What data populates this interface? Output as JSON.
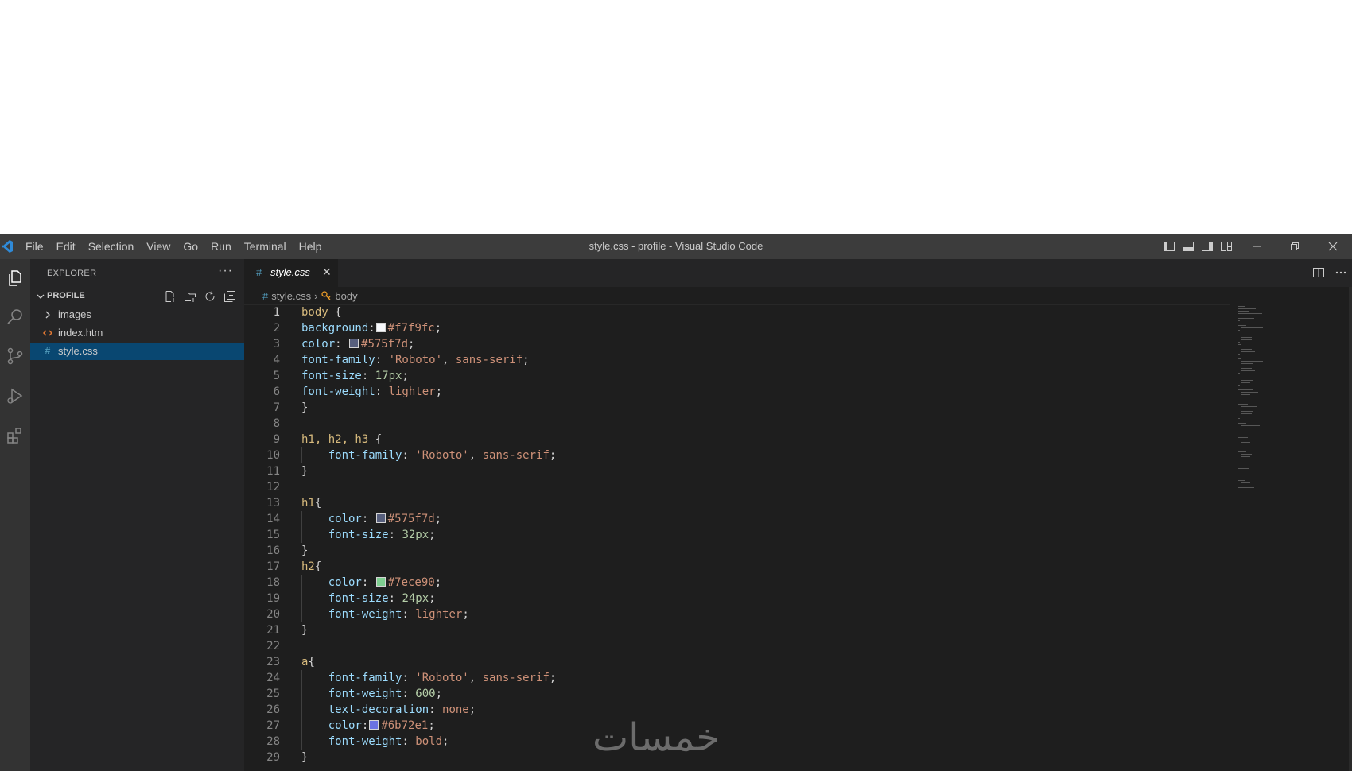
{
  "window": {
    "title": "style.css - profile - Visual Studio Code",
    "menu": [
      "File",
      "Edit",
      "Selection",
      "View",
      "Go",
      "Run",
      "Terminal",
      "Help"
    ]
  },
  "sidebar": {
    "header": "EXPLORER",
    "more": "···",
    "section": "PROFILE",
    "items": [
      {
        "label": "images",
        "kind": "folder"
      },
      {
        "label": "index.htm",
        "kind": "html"
      },
      {
        "label": "style.css",
        "kind": "css",
        "selected": true
      }
    ]
  },
  "editor": {
    "tab": {
      "icon": "#",
      "label": "style.css",
      "close": "✕"
    },
    "breadcrumb": {
      "file": "style.css",
      "separator": "›",
      "symbol": "body"
    },
    "lines": [
      {
        "n": "1",
        "tokens": [
          [
            "sel",
            "body "
          ],
          [
            "punc",
            "{"
          ]
        ]
      },
      {
        "n": "2",
        "tokens": [
          [
            "prop",
            "background"
          ],
          [
            "punc",
            ":"
          ],
          [
            "swatch",
            "#f7f9fc"
          ],
          [
            "val",
            "#f7f9fc"
          ],
          [
            "punc",
            ";"
          ]
        ]
      },
      {
        "n": "3",
        "tokens": [
          [
            "prop",
            "color"
          ],
          [
            "punc",
            ": "
          ],
          [
            "swatch",
            "#575f7d"
          ],
          [
            "val",
            "#575f7d"
          ],
          [
            "punc",
            ";"
          ]
        ]
      },
      {
        "n": "4",
        "tokens": [
          [
            "prop",
            "font-family"
          ],
          [
            "punc",
            ": "
          ],
          [
            "val",
            "'Roboto'"
          ],
          [
            "punc",
            ", "
          ],
          [
            "val",
            "sans-serif"
          ],
          [
            "punc",
            ";"
          ]
        ]
      },
      {
        "n": "5",
        "tokens": [
          [
            "prop",
            "font-size"
          ],
          [
            "punc",
            ": "
          ],
          [
            "num",
            "17px"
          ],
          [
            "punc",
            ";"
          ]
        ]
      },
      {
        "n": "6",
        "tokens": [
          [
            "prop",
            "font-weight"
          ],
          [
            "punc",
            ": "
          ],
          [
            "val",
            "lighter"
          ],
          [
            "punc",
            ";"
          ]
        ]
      },
      {
        "n": "7",
        "tokens": [
          [
            "punc",
            "}"
          ]
        ]
      },
      {
        "n": "8",
        "tokens": []
      },
      {
        "n": "9",
        "tokens": [
          [
            "sel",
            "h1, h2, h3 "
          ],
          [
            "punc",
            "{"
          ]
        ]
      },
      {
        "n": "10",
        "indent": true,
        "tokens": [
          [
            "prop",
            "    font-family"
          ],
          [
            "punc",
            ": "
          ],
          [
            "val",
            "'Roboto'"
          ],
          [
            "punc",
            ", "
          ],
          [
            "val",
            "sans-serif"
          ],
          [
            "punc",
            ";"
          ]
        ]
      },
      {
        "n": "11",
        "tokens": [
          [
            "punc",
            "}"
          ]
        ]
      },
      {
        "n": "12",
        "tokens": []
      },
      {
        "n": "13",
        "tokens": [
          [
            "sel",
            "h1"
          ],
          [
            "punc",
            "{"
          ]
        ]
      },
      {
        "n": "14",
        "indent": true,
        "tokens": [
          [
            "prop",
            "    color"
          ],
          [
            "punc",
            ": "
          ],
          [
            "swatch",
            "#575f7d"
          ],
          [
            "val",
            "#575f7d"
          ],
          [
            "punc",
            ";"
          ]
        ]
      },
      {
        "n": "15",
        "indent": true,
        "tokens": [
          [
            "prop",
            "    font-size"
          ],
          [
            "punc",
            ": "
          ],
          [
            "num",
            "32px"
          ],
          [
            "punc",
            ";"
          ]
        ]
      },
      {
        "n": "16",
        "tokens": [
          [
            "punc",
            "}"
          ]
        ]
      },
      {
        "n": "17",
        "tokens": [
          [
            "sel",
            "h2"
          ],
          [
            "punc",
            "{"
          ]
        ]
      },
      {
        "n": "18",
        "indent": true,
        "tokens": [
          [
            "prop",
            "    color"
          ],
          [
            "punc",
            ": "
          ],
          [
            "swatch",
            "#7ece90"
          ],
          [
            "val",
            "#7ece90"
          ],
          [
            "punc",
            ";"
          ]
        ]
      },
      {
        "n": "19",
        "indent": true,
        "tokens": [
          [
            "prop",
            "    font-size"
          ],
          [
            "punc",
            ": "
          ],
          [
            "num",
            "24px"
          ],
          [
            "punc",
            ";"
          ]
        ]
      },
      {
        "n": "20",
        "indent": true,
        "tokens": [
          [
            "prop",
            "    font-weight"
          ],
          [
            "punc",
            ": "
          ],
          [
            "val",
            "lighter"
          ],
          [
            "punc",
            ";"
          ]
        ]
      },
      {
        "n": "21",
        "tokens": [
          [
            "punc",
            "}"
          ]
        ]
      },
      {
        "n": "22",
        "tokens": []
      },
      {
        "n": "23",
        "tokens": [
          [
            "sel",
            "a"
          ],
          [
            "punc",
            "{"
          ]
        ]
      },
      {
        "n": "24",
        "indent": true,
        "tokens": [
          [
            "prop",
            "    font-family"
          ],
          [
            "punc",
            ": "
          ],
          [
            "val",
            "'Roboto'"
          ],
          [
            "punc",
            ", "
          ],
          [
            "val",
            "sans-serif"
          ],
          [
            "punc",
            ";"
          ]
        ]
      },
      {
        "n": "25",
        "indent": true,
        "tokens": [
          [
            "prop",
            "    font-weight"
          ],
          [
            "punc",
            ": "
          ],
          [
            "num",
            "600"
          ],
          [
            "punc",
            ";"
          ]
        ]
      },
      {
        "n": "26",
        "indent": true,
        "tokens": [
          [
            "prop",
            "    text-decoration"
          ],
          [
            "punc",
            ": "
          ],
          [
            "val",
            "none"
          ],
          [
            "punc",
            ";"
          ]
        ]
      },
      {
        "n": "27",
        "indent": true,
        "tokens": [
          [
            "prop",
            "    color"
          ],
          [
            "punc",
            ":"
          ],
          [
            "swatch",
            "#6b72e1"
          ],
          [
            "val",
            "#6b72e1"
          ],
          [
            "punc",
            ";"
          ]
        ]
      },
      {
        "n": "28",
        "indent": true,
        "tokens": [
          [
            "prop",
            "    font-weight"
          ],
          [
            "punc",
            ": "
          ],
          [
            "val",
            "bold"
          ],
          [
            "punc",
            ";"
          ]
        ]
      },
      {
        "n": "29",
        "tokens": [
          [
            "punc",
            "}"
          ]
        ]
      }
    ]
  },
  "watermark": "خمسات",
  "colors": {
    "titlebar": "#3c3c3c",
    "activitybar": "#333333",
    "sidebar": "#252526",
    "editor": "#1e1e1e",
    "selection": "#094771",
    "accent": "#007acc"
  }
}
